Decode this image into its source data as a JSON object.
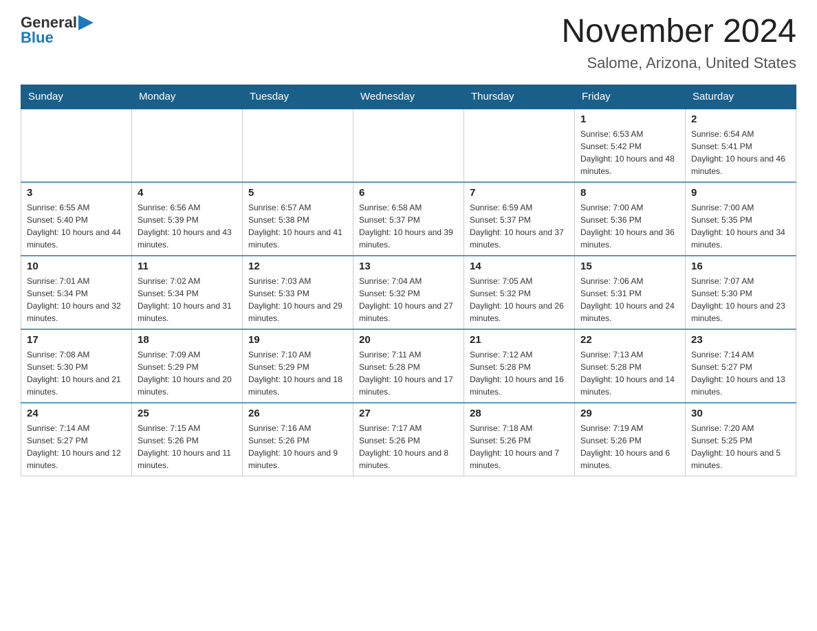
{
  "logo": {
    "general": "General",
    "blue": "Blue"
  },
  "title": "November 2024",
  "subtitle": "Salome, Arizona, United States",
  "days_of_week": [
    "Sunday",
    "Monday",
    "Tuesday",
    "Wednesday",
    "Thursday",
    "Friday",
    "Saturday"
  ],
  "weeks": [
    [
      {
        "day": "",
        "info": ""
      },
      {
        "day": "",
        "info": ""
      },
      {
        "day": "",
        "info": ""
      },
      {
        "day": "",
        "info": ""
      },
      {
        "day": "",
        "info": ""
      },
      {
        "day": "1",
        "info": "Sunrise: 6:53 AM\nSunset: 5:42 PM\nDaylight: 10 hours and 48 minutes."
      },
      {
        "day": "2",
        "info": "Sunrise: 6:54 AM\nSunset: 5:41 PM\nDaylight: 10 hours and 46 minutes."
      }
    ],
    [
      {
        "day": "3",
        "info": "Sunrise: 6:55 AM\nSunset: 5:40 PM\nDaylight: 10 hours and 44 minutes."
      },
      {
        "day": "4",
        "info": "Sunrise: 6:56 AM\nSunset: 5:39 PM\nDaylight: 10 hours and 43 minutes."
      },
      {
        "day": "5",
        "info": "Sunrise: 6:57 AM\nSunset: 5:38 PM\nDaylight: 10 hours and 41 minutes."
      },
      {
        "day": "6",
        "info": "Sunrise: 6:58 AM\nSunset: 5:37 PM\nDaylight: 10 hours and 39 minutes."
      },
      {
        "day": "7",
        "info": "Sunrise: 6:59 AM\nSunset: 5:37 PM\nDaylight: 10 hours and 37 minutes."
      },
      {
        "day": "8",
        "info": "Sunrise: 7:00 AM\nSunset: 5:36 PM\nDaylight: 10 hours and 36 minutes."
      },
      {
        "day": "9",
        "info": "Sunrise: 7:00 AM\nSunset: 5:35 PM\nDaylight: 10 hours and 34 minutes."
      }
    ],
    [
      {
        "day": "10",
        "info": "Sunrise: 7:01 AM\nSunset: 5:34 PM\nDaylight: 10 hours and 32 minutes."
      },
      {
        "day": "11",
        "info": "Sunrise: 7:02 AM\nSunset: 5:34 PM\nDaylight: 10 hours and 31 minutes."
      },
      {
        "day": "12",
        "info": "Sunrise: 7:03 AM\nSunset: 5:33 PM\nDaylight: 10 hours and 29 minutes."
      },
      {
        "day": "13",
        "info": "Sunrise: 7:04 AM\nSunset: 5:32 PM\nDaylight: 10 hours and 27 minutes."
      },
      {
        "day": "14",
        "info": "Sunrise: 7:05 AM\nSunset: 5:32 PM\nDaylight: 10 hours and 26 minutes."
      },
      {
        "day": "15",
        "info": "Sunrise: 7:06 AM\nSunset: 5:31 PM\nDaylight: 10 hours and 24 minutes."
      },
      {
        "day": "16",
        "info": "Sunrise: 7:07 AM\nSunset: 5:30 PM\nDaylight: 10 hours and 23 minutes."
      }
    ],
    [
      {
        "day": "17",
        "info": "Sunrise: 7:08 AM\nSunset: 5:30 PM\nDaylight: 10 hours and 21 minutes."
      },
      {
        "day": "18",
        "info": "Sunrise: 7:09 AM\nSunset: 5:29 PM\nDaylight: 10 hours and 20 minutes."
      },
      {
        "day": "19",
        "info": "Sunrise: 7:10 AM\nSunset: 5:29 PM\nDaylight: 10 hours and 18 minutes."
      },
      {
        "day": "20",
        "info": "Sunrise: 7:11 AM\nSunset: 5:28 PM\nDaylight: 10 hours and 17 minutes."
      },
      {
        "day": "21",
        "info": "Sunrise: 7:12 AM\nSunset: 5:28 PM\nDaylight: 10 hours and 16 minutes."
      },
      {
        "day": "22",
        "info": "Sunrise: 7:13 AM\nSunset: 5:28 PM\nDaylight: 10 hours and 14 minutes."
      },
      {
        "day": "23",
        "info": "Sunrise: 7:14 AM\nSunset: 5:27 PM\nDaylight: 10 hours and 13 minutes."
      }
    ],
    [
      {
        "day": "24",
        "info": "Sunrise: 7:14 AM\nSunset: 5:27 PM\nDaylight: 10 hours and 12 minutes."
      },
      {
        "day": "25",
        "info": "Sunrise: 7:15 AM\nSunset: 5:26 PM\nDaylight: 10 hours and 11 minutes."
      },
      {
        "day": "26",
        "info": "Sunrise: 7:16 AM\nSunset: 5:26 PM\nDaylight: 10 hours and 9 minutes."
      },
      {
        "day": "27",
        "info": "Sunrise: 7:17 AM\nSunset: 5:26 PM\nDaylight: 10 hours and 8 minutes."
      },
      {
        "day": "28",
        "info": "Sunrise: 7:18 AM\nSunset: 5:26 PM\nDaylight: 10 hours and 7 minutes."
      },
      {
        "day": "29",
        "info": "Sunrise: 7:19 AM\nSunset: 5:26 PM\nDaylight: 10 hours and 6 minutes."
      },
      {
        "day": "30",
        "info": "Sunrise: 7:20 AM\nSunset: 5:25 PM\nDaylight: 10 hours and 5 minutes."
      }
    ]
  ]
}
